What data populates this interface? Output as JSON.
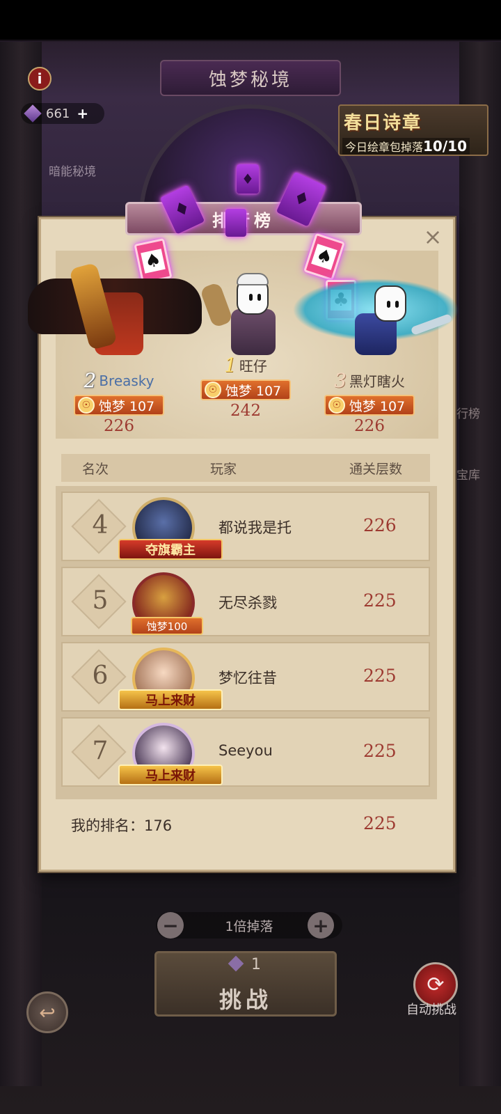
{
  "header": {
    "title": "蚀梦秘境",
    "currency_amount": "661",
    "currency_plus": "+",
    "sub_label": "暗能秘境",
    "info_icon": "i"
  },
  "event": {
    "title": "春日诗章",
    "subtitle": "今日绘章包掉落",
    "progress": "10/10"
  },
  "leaderboard": {
    "tab_title": "排行榜",
    "close": "×",
    "podium": [
      {
        "rank": "2",
        "name": "Breasky",
        "badge": "蚀梦 107",
        "score": "226"
      },
      {
        "rank": "1",
        "name": "旺仔",
        "badge": "蚀梦 107",
        "score": "242"
      },
      {
        "rank": "3",
        "name": "黑灯瞎火",
        "badge": "蚀梦 107",
        "score": "226"
      }
    ],
    "columns": {
      "rank": "名次",
      "player": "玩家",
      "floors": "通关层数"
    },
    "rows": [
      {
        "rank": "4",
        "name": "都说我是托",
        "score": "226",
        "plate": "夺旗霸主"
      },
      {
        "rank": "5",
        "name": "无尽杀戮",
        "score": "225",
        "plate": "蚀梦100"
      },
      {
        "rank": "6",
        "name": "梦忆往昔",
        "score": "225",
        "plate": "马上来财"
      },
      {
        "rank": "7",
        "name": "Seeyou",
        "score": "225",
        "plate": "马上来财"
      }
    ],
    "my_rank_label": "我的排名：176",
    "my_score": "225"
  },
  "side": {
    "label_1": "行榜",
    "label_2": "宝库"
  },
  "bottom": {
    "drop_label": "1倍掉落",
    "minus": "−",
    "plus": "+",
    "challenge_cost": "1",
    "challenge_label": "挑战",
    "auto_label": "自动挑战"
  }
}
